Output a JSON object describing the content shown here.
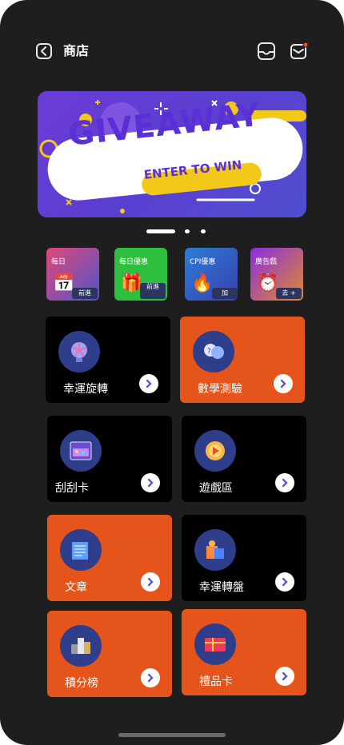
{
  "header": {
    "title": "商店",
    "back_icon": "chevron-left-icon",
    "inbox_icon": "inbox-icon",
    "mail_icon": "mail-icon"
  },
  "banner": {
    "headline": "GIVEAWAY",
    "subline": "ENTER TO WIN",
    "colors": {
      "bg": "#5a3fd0",
      "accent": "#f2c919"
    }
  },
  "carousel": {
    "pages": 3,
    "active": 1
  },
  "quick_tiles": [
    {
      "label": "每日",
      "button": "前進",
      "icon": "calendar-icon"
    },
    {
      "label": "每日優惠",
      "button": "前進",
      "icon": "gift-icon"
    },
    {
      "label": "CPI優惠",
      "button": "加",
      "icon": "fire-icon"
    },
    {
      "label": "廣告戲",
      "button": "去 +",
      "icon": "alarm-clock-icon"
    }
  ],
  "cards": [
    {
      "label": "幸運旋轉",
      "icon": "spin-wheel-icon",
      "theme": "black"
    },
    {
      "label": "數學測驗",
      "icon": "quiz-icon",
      "theme": "orange"
    },
    {
      "label": "刮刮卡",
      "icon": "scratch-card-icon",
      "theme": "black"
    },
    {
      "label": "遊戲區",
      "icon": "game-icon",
      "theme": "black"
    },
    {
      "label": "文章",
      "icon": "article-icon",
      "theme": "orange"
    },
    {
      "label": "幸運轉盤",
      "icon": "lucky-box-icon",
      "theme": "black"
    },
    {
      "label": "積分榜",
      "icon": "leaderboard-icon",
      "theme": "orange"
    },
    {
      "label": "禮品卡",
      "icon": "gift-card-icon",
      "theme": "orange"
    }
  ]
}
